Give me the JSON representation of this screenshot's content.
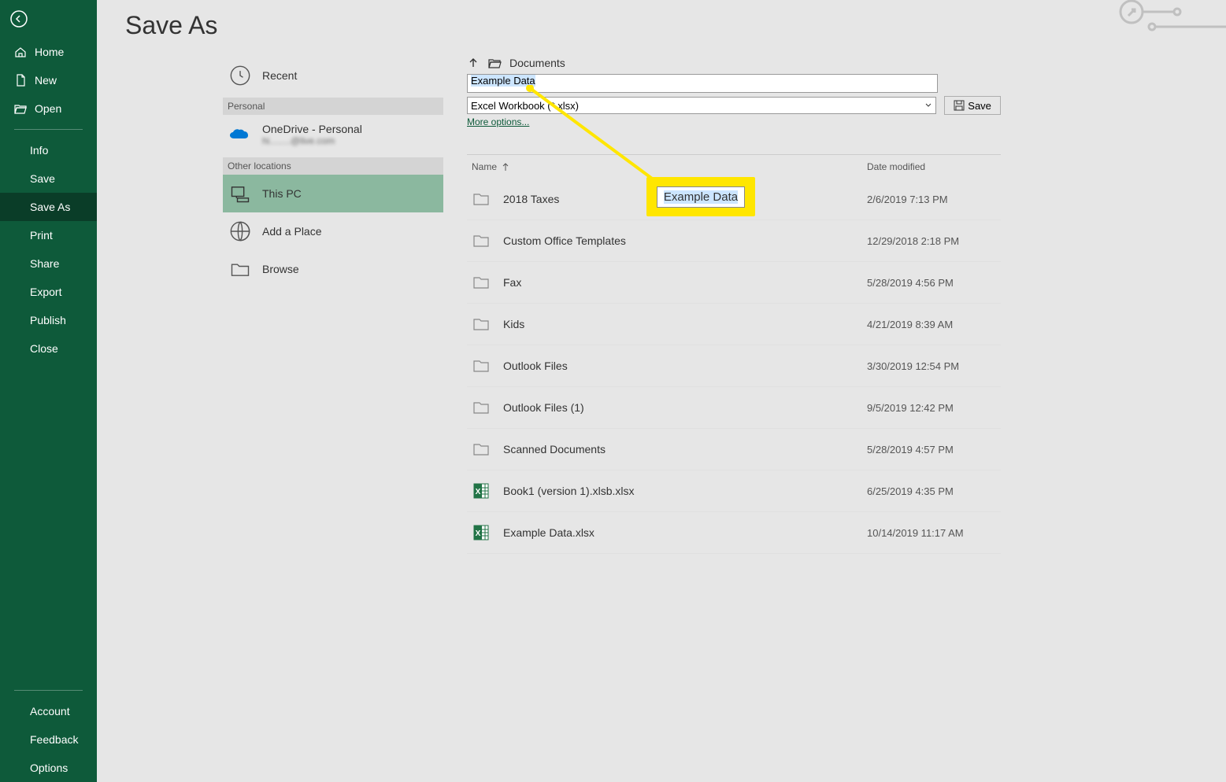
{
  "page": {
    "title": "Save As"
  },
  "sidebar": {
    "top": [
      {
        "label": "Home",
        "icon": "home"
      },
      {
        "label": "New",
        "icon": "file"
      },
      {
        "label": "Open",
        "icon": "folder-open"
      }
    ],
    "mid": [
      "Info",
      "Save",
      "Save As",
      "Print",
      "Share",
      "Export",
      "Publish",
      "Close"
    ],
    "active": "Save As",
    "bottom": [
      "Account",
      "Feedback",
      "Options"
    ]
  },
  "locations": {
    "recent_label": "Recent",
    "personal_header": "Personal",
    "onedrive_label": "OneDrive - Personal",
    "onedrive_sub": "hi........@live.com",
    "other_header": "Other locations",
    "thispc_label": "This PC",
    "addplace_label": "Add a Place",
    "browse_label": "Browse"
  },
  "filepanel": {
    "breadcrumb": "Documents",
    "filename": "Example Data",
    "filetype": "Excel Workbook (*.xlsx)",
    "save_label": "Save",
    "more_options": "More options...",
    "col_name": "Name",
    "col_date": "Date modified"
  },
  "files": [
    {
      "name": "2018 Taxes",
      "date": "2/6/2019 7:13 PM",
      "type": "folder"
    },
    {
      "name": "Custom Office Templates",
      "date": "12/29/2018 2:18 PM",
      "type": "folder"
    },
    {
      "name": "Fax",
      "date": "5/28/2019 4:56 PM",
      "type": "folder"
    },
    {
      "name": "Kids",
      "date": "4/21/2019 8:39 AM",
      "type": "folder"
    },
    {
      "name": "Outlook Files",
      "date": "3/30/2019 12:54 PM",
      "type": "folder"
    },
    {
      "name": "Outlook Files (1)",
      "date": "9/5/2019 12:42 PM",
      "type": "folder"
    },
    {
      "name": "Scanned Documents",
      "date": "5/28/2019 4:57 PM",
      "type": "folder"
    },
    {
      "name": "Book1 (version 1).xlsb.xlsx",
      "date": "6/25/2019 4:35 PM",
      "type": "excel"
    },
    {
      "name": "Example Data.xlsx",
      "date": "10/14/2019 11:17 AM",
      "type": "excel"
    }
  ],
  "callout": {
    "text": "Example Data"
  }
}
